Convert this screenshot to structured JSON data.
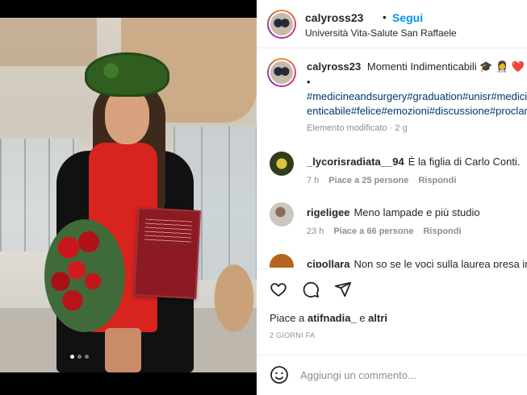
{
  "post": {
    "username": "calyross23",
    "separator": "•",
    "follow_label": "Segui",
    "location": "Università Vita-Salute San Raffaele",
    "caption_username": "calyross23",
    "caption_text": "Momenti Indimenticabili",
    "caption_emojis": "🎓 👩‍⚕️ ❤️",
    "caption_bullet": "•",
    "hashtags_line1": "#medicineandsurgery#graduation#unisr#medicinainglese#mom",
    "hashtags_line2": "enticabile#felice#emozioni#discussione#proclamazione",
    "meta": "Elemento modificato · 2 g",
    "photo_slides": 3,
    "active_slide": 1
  },
  "comments": [
    {
      "username": "_lycorisradiata__94",
      "text": "È la figlia di Carlo Conti.",
      "time": "7 h",
      "likes": "Piace a 25 persone",
      "reply": "Rispondi"
    },
    {
      "username": "rigeligee",
      "text": "Meno lampade e più studio",
      "time": "23 h",
      "likes": "Piace a 66 persone",
      "reply": "Rispondi"
    },
    {
      "username": "cipollara",
      "text": "Non so se le voci sulla laurea presa in",
      "time": "",
      "likes": "",
      "reply": ""
    }
  ],
  "actions": {
    "likes_prefix": "Piace a",
    "likes_user": "atifnadia_",
    "likes_mid": "e",
    "likes_others": "altri",
    "timestamp": "2 GIORNI FA"
  },
  "add_comment": {
    "placeholder": "Aggiungi un commento..."
  },
  "icons": {
    "like": "heart-icon",
    "comment": "comment-bubble-icon",
    "share": "paper-plane-icon",
    "emoji": "smiley-icon"
  },
  "colors": {
    "follow": "#0095f6",
    "hashtag": "#00376b",
    "muted": "#8e8e8e",
    "text": "#262626"
  }
}
